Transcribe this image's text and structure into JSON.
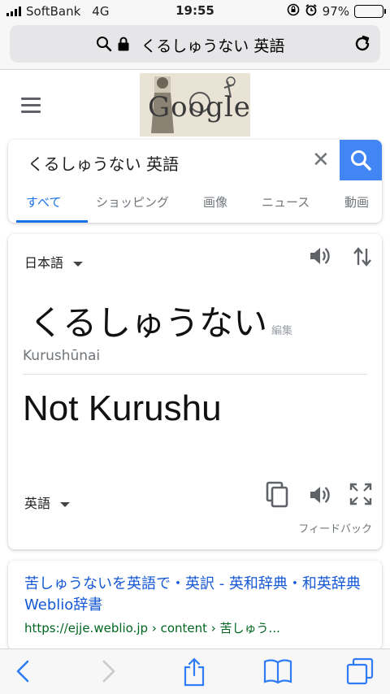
{
  "status": {
    "carrier": "SoftBank",
    "network": "4G",
    "time": "19:55",
    "battery": "97%",
    "battery_level": 0.97
  },
  "browser": {
    "url_text": "くるしゅうない 英語",
    "icons": [
      "search-icon",
      "lock-icon",
      "reload-icon"
    ]
  },
  "google": {
    "doodle_text": "Google"
  },
  "search": {
    "query": "くるしゅうない 英語",
    "clear_label": "✕",
    "tabs": [
      {
        "label": "すべて",
        "active": true
      },
      {
        "label": "ショッピング",
        "active": false
      },
      {
        "label": "画像",
        "active": false
      },
      {
        "label": "ニュース",
        "active": false
      },
      {
        "label": "動画",
        "active": false
      }
    ],
    "accent_color": "#4285f4"
  },
  "translate": {
    "source_language": "日本語",
    "source_text": "くるしゅうない",
    "edit_label": "編集",
    "romanization": "Kurushūnai",
    "target_text": "Not Kurushu",
    "target_language": "英語",
    "feedback_label": "フィードバック"
  },
  "result": {
    "title": "苦しゅうないを英語で・英訳 - 英和辞典・和英辞典 Weblio辞書",
    "url": "https://ejje.weblio.jp › content › 苦しゅう..."
  },
  "toolbar": {
    "icons": [
      "back-icon",
      "forward-icon",
      "share-icon",
      "bookmarks-icon",
      "tabs-icon"
    ]
  }
}
